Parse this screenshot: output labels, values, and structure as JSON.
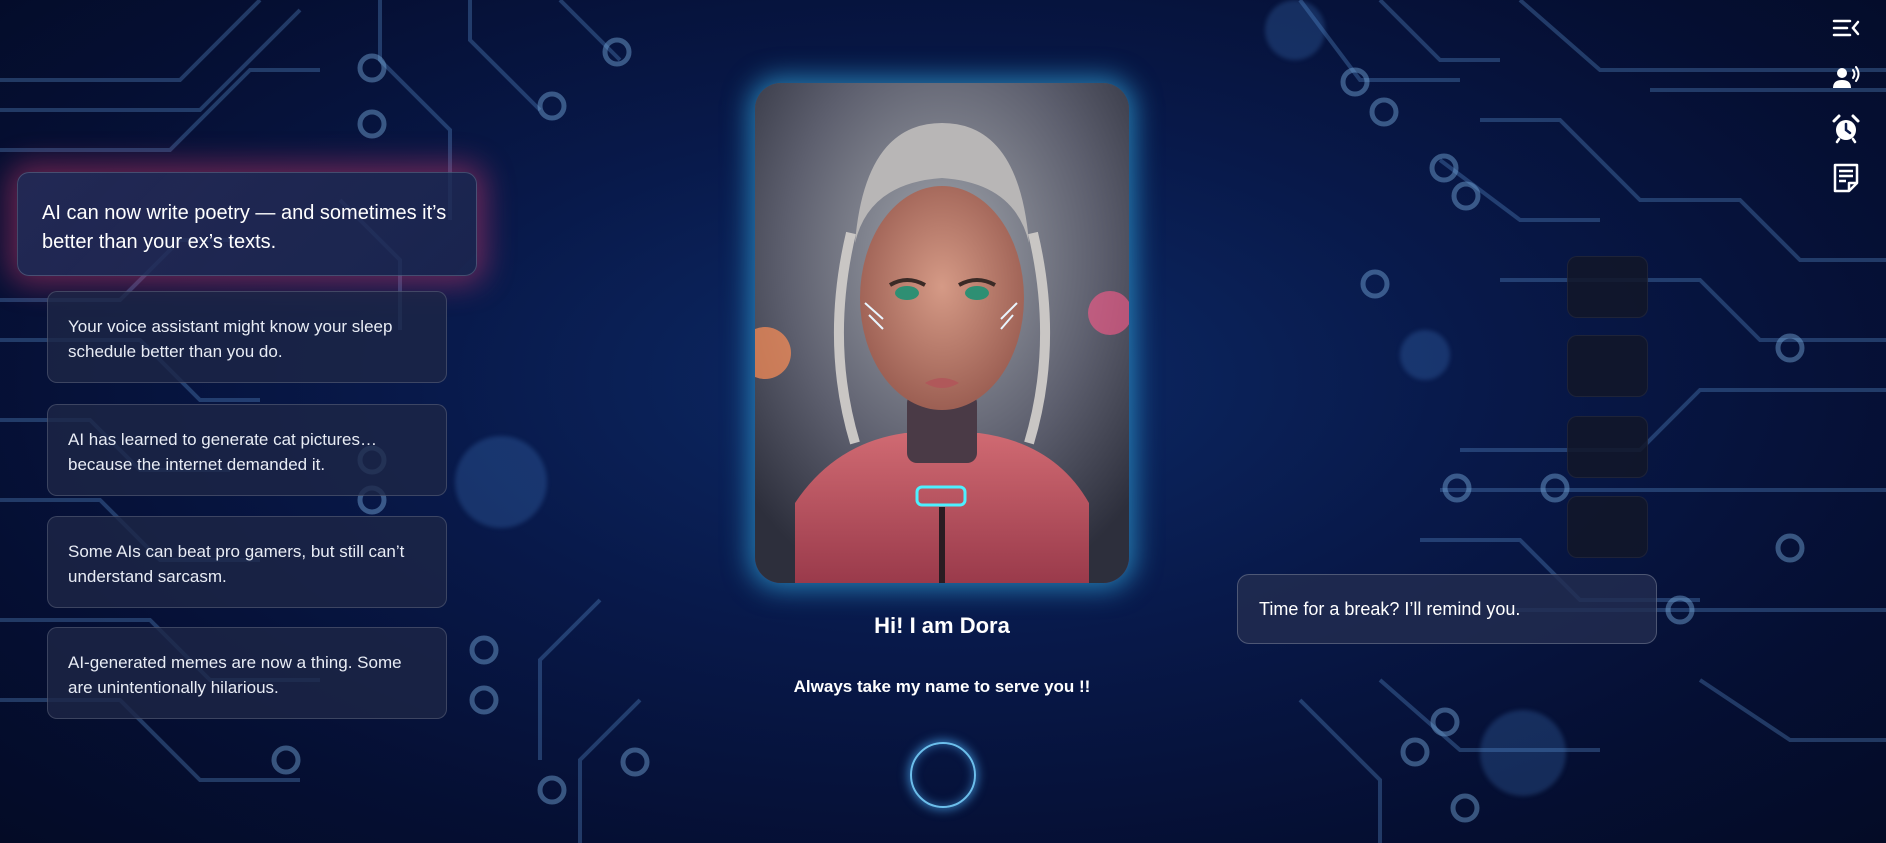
{
  "facts": {
    "featured": "AI can now write poetry — and sometimes it’s better than your ex’s texts.",
    "items": [
      "Your voice assistant might know your sleep schedule better than you do.",
      "AI has learned to generate cat pictures… because the internet demanded it.",
      "Some AIs can beat pro gamers, but still can’t understand sarcasm.",
      "AI-generated memes are now a thing. Some are unintentionally hilarious."
    ]
  },
  "assistant": {
    "greeting": "Hi! I am Dora",
    "tagline": "Always take my name to serve you !!"
  },
  "reminder": {
    "text": "Time for a break? I’ll remind you."
  },
  "toolbar": {
    "icons": [
      "menu-collapse-icon",
      "voice-user-icon",
      "alarm-clock-icon",
      "notes-icon"
    ]
  },
  "colors": {
    "background": "#08194a",
    "accent_glow": "#3cc8ff",
    "featured_glow": "#e63c6e"
  }
}
